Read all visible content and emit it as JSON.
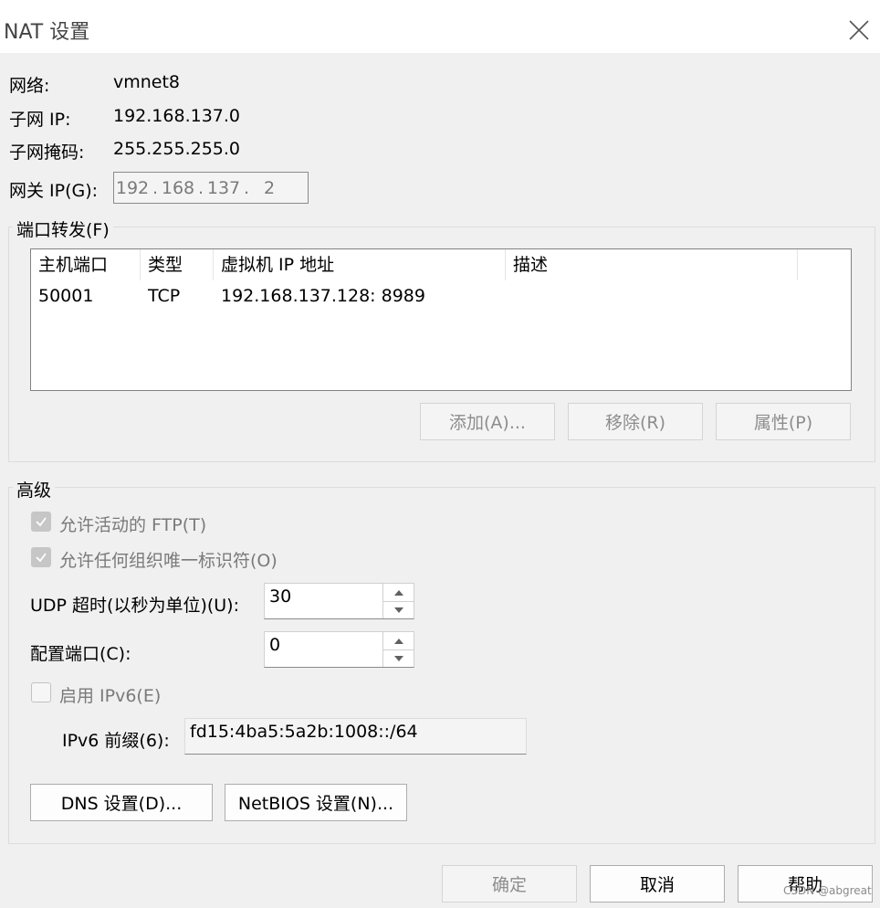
{
  "window": {
    "title": "NAT 设置",
    "close_icon": "close-icon"
  },
  "info": {
    "network_label": "网络:",
    "network_value": "vmnet8",
    "subnet_ip_label": "子网 IP:",
    "subnet_ip_value": "192.168.137.0",
    "subnet_mask_label": "子网掩码:",
    "subnet_mask_value": "255.255.255.0",
    "gateway_label": "网关 IP(G):",
    "gateway_octets": [
      "192",
      "168",
      "137",
      "2"
    ]
  },
  "port_forwarding": {
    "group_label": "端口转发(F)",
    "columns": [
      "主机端口",
      "类型",
      "虚拟机 IP 地址",
      "描述"
    ],
    "rows": [
      {
        "host_port": "50001",
        "type": "TCP",
        "vm_ip": "192.168.137.128: 8989",
        "description": ""
      }
    ],
    "add_label": "添加(A)...",
    "remove_label": "移除(R)",
    "properties_label": "属性(P)"
  },
  "advanced": {
    "group_label": "高级",
    "allow_ftp_label": "允许活动的 FTP(T)",
    "allow_ftp_checked": true,
    "allow_oui_label": "允许任何组织唯一标识符(O)",
    "allow_oui_checked": true,
    "udp_timeout_label": "UDP 超时(以秒为单位)(U):",
    "udp_timeout_value": "30",
    "config_port_label": "配置端口(C):",
    "config_port_value": "0",
    "enable_ipv6_label": "启用 IPv6(E)",
    "enable_ipv6_checked": false,
    "ipv6_prefix_label": "IPv6 前缀(6):",
    "ipv6_prefix_value": "fd15:4ba5:5a2b:1008::/64",
    "dns_button_label": "DNS 设置(D)...",
    "netbios_button_label": "NetBIOS 设置(N)..."
  },
  "footer": {
    "ok_label": "确定",
    "cancel_label": "取消",
    "help_label": "帮助",
    "watermark": "CSDN @abgreat"
  },
  "colors": {
    "dialog_bg": "#f0f0f0",
    "disabled_text": "#8d8d8d",
    "checkbox_checked_bg": "#c6c6c6"
  }
}
